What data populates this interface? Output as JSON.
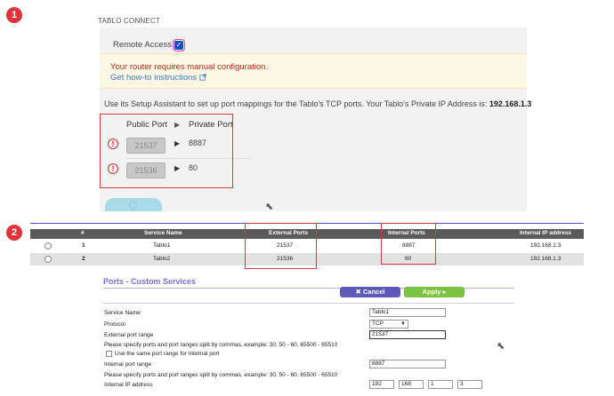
{
  "badges": [
    "1",
    "2"
  ],
  "tablo": {
    "title": "TABLO CONNECT",
    "remote_access_label": "Remote Access",
    "remote_access_checked": true,
    "warning_text": "Your router requires manual configuration.",
    "howto_link": "Get how-to instructions",
    "setup_text_prefix": "Use its Setup Assistant to set up port mappings for the Tablo's TCP ports. Your Tablo's Private IP Address is:",
    "private_ip": "192.168.1.3",
    "headers": {
      "public_port": "Public Port",
      "private_port": "Private Port"
    },
    "rows": [
      {
        "public_port": "21537",
        "private_port": "8887"
      },
      {
        "public_port": "21536",
        "private_port": "80"
      }
    ],
    "alert_glyph": "!",
    "arrow_glyph": "▶",
    "accent_color": "#a9dbe6"
  },
  "table": {
    "headers": {
      "num": "#",
      "service": "Service Name",
      "external": "External Ports",
      "internal": "Internal Ports",
      "ip": "Internal IP address"
    },
    "rows": [
      {
        "num": "1",
        "service": "Tablo1",
        "external": "21537",
        "internal": "8887",
        "ip": "192.168.1.3"
      },
      {
        "num": "2",
        "service": "Tablo2",
        "external": "21536",
        "internal": "80",
        "ip": "192.168.1.3"
      }
    ],
    "header_color": "#5a5a5a"
  },
  "form": {
    "title": "Ports - Custom Services",
    "cancel_label": "Cancel",
    "apply_label": "Apply",
    "cancel_icon": "✖",
    "apply_icon": "▸",
    "service_name_label": "Service Name",
    "service_name_value": "Tablo1",
    "protocol_label": "Protocol",
    "protocol_value": "TCP",
    "external_range_label": "External port range",
    "external_range_value": "21537",
    "hint_text": "Please specify ports and port ranges split by commas, example: 30, 50 - 60, 65500 - 65510",
    "same_range_label": "Use the same port range for Internal port",
    "internal_range_label": "Internal port range",
    "internal_range_value": "8887",
    "internal_ip_label": "Internal IP address",
    "ip_octets": [
      "192",
      "168",
      "1",
      "3"
    ],
    "cancel_color": "#5e5ab8",
    "apply_color": "#7cc243"
  }
}
